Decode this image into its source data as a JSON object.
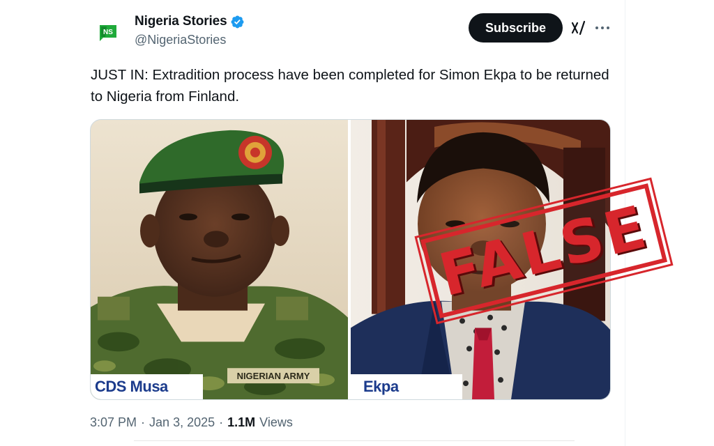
{
  "author": {
    "display_name": "Nigeria Stories",
    "handle": "@NigeriaStories",
    "avatar_text": "NS"
  },
  "header": {
    "subscribe_label": "Subscribe"
  },
  "icons": {
    "verified": "verified-badge-icon",
    "grok": "grok-icon",
    "more": "more-options-icon"
  },
  "tweet": {
    "text": "JUST IN: Extradition process have been completed for Simon Ekpa to be returned to Nigeria from Finland."
  },
  "media": {
    "left_caption": "CDS Musa",
    "right_caption": "Ekpa",
    "stamp_text": "FALSE",
    "uniform_tape": "NIGERIAN ARMY"
  },
  "meta": {
    "time": "3:07 PM",
    "date": "Jan 3, 2025",
    "views_count": "1.1M",
    "views_label": "Views",
    "separator": "·"
  },
  "colors": {
    "verified_blue": "#1d9bf0",
    "stamp_red": "#d7262c",
    "caption_blue": "#1b3b8c",
    "subscribe_bg": "#0f1419"
  }
}
